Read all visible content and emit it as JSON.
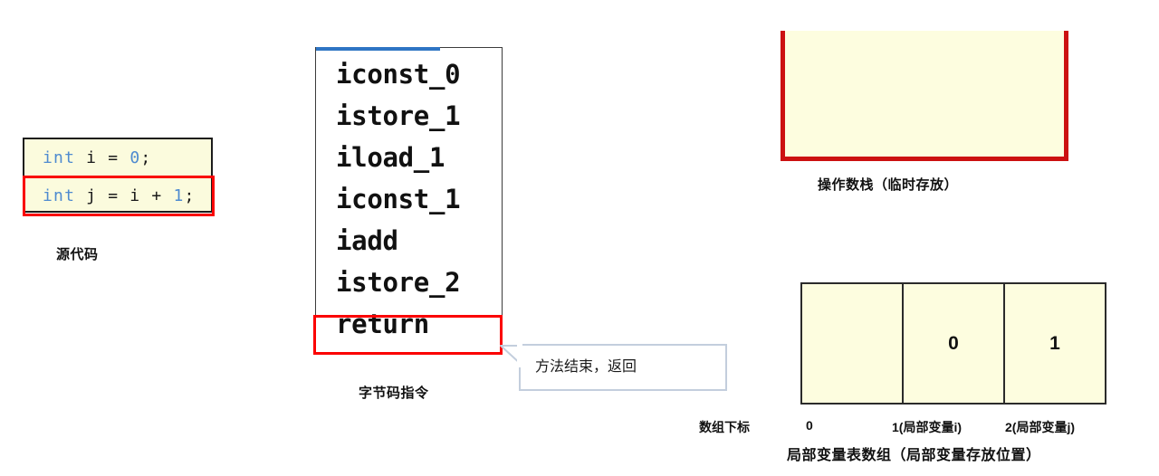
{
  "source_code": {
    "caption": "源代码",
    "lines": [
      {
        "keyword": "int",
        "rest": " i = ",
        "value": "0",
        "tail": ";",
        "highlighted": false
      },
      {
        "keyword": "int",
        "rest": " j = i + ",
        "value": "1",
        "tail": ";",
        "highlighted": true
      }
    ]
  },
  "bytecode": {
    "caption": "字节码指令",
    "instructions": [
      "iconst_0",
      "istore_1",
      "iload_1",
      "iconst_1",
      "iadd",
      "istore_2",
      "return"
    ],
    "highlighted_instruction": "return",
    "accent_color": "#2e75c4",
    "highlight_color": "#fb0000"
  },
  "callout": {
    "text": "方法结束，返回",
    "border_color": "#c3cedd"
  },
  "operand_stack": {
    "caption": "操作数栈（临时存放）",
    "items": [],
    "border_color": "#cc1111",
    "fill_color": "#fdfddf"
  },
  "local_variable_table": {
    "caption": "局部变量表数组（局部变量存放位置）",
    "axis_title": "数组下标",
    "cells": [
      {
        "index_label": "0",
        "value": ""
      },
      {
        "index_label": "1(局部变量i)",
        "value": "0"
      },
      {
        "index_label": "2(局部变量j)",
        "value": "1"
      }
    ],
    "fill_color": "#fdfddf"
  }
}
